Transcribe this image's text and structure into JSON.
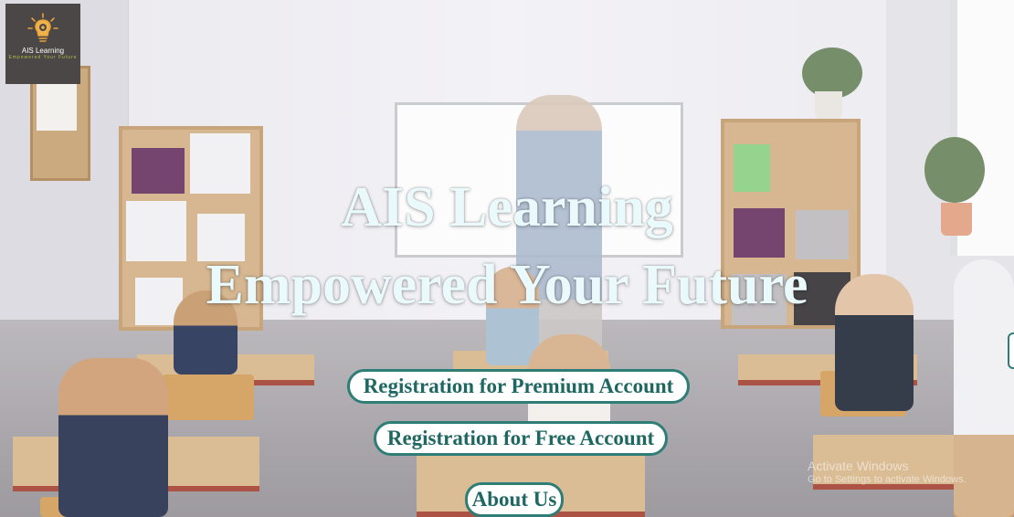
{
  "logo": {
    "name": "AIS Learning",
    "tagline": "Empowered Your Future"
  },
  "hero": {
    "title_line1": "AIS Learning",
    "title_line2": "Empowered Your Future"
  },
  "buttons": {
    "premium": "Registration for Premium Account",
    "free": "Registration for Free Account",
    "about": "About Us"
  },
  "watermark": {
    "title": "Activate Windows",
    "subtitle": "Go to Settings to activate Windows."
  },
  "colors": {
    "accent": "#2e7d76",
    "button_text": "#1f6762",
    "title_text": "#eaf9fb",
    "logo_bg": "#4a4746"
  },
  "icons": {
    "logo": "lightbulb-gear-icon"
  }
}
